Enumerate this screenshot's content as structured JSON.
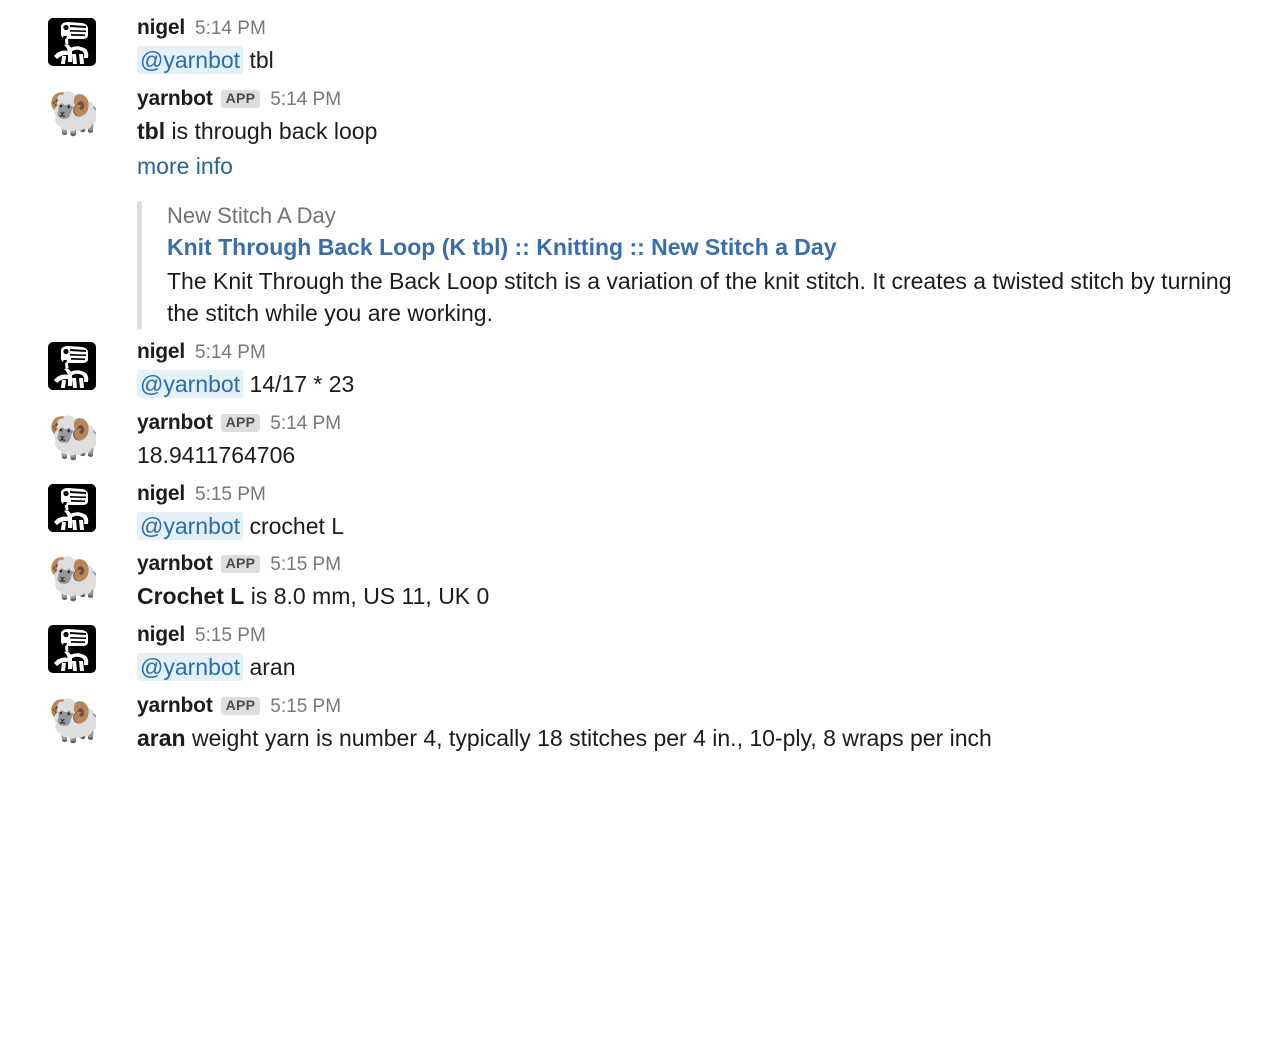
{
  "app": "slack",
  "colors": {
    "mention_bg": "#e4f1f8",
    "mention_text": "#2a6cae",
    "link": "#2a6496",
    "attachment_bar": "#dddddd",
    "attachment_title": "#3a6ea8",
    "app_badge_bg": "#dddddd",
    "timestamp": "#787878",
    "body_text": "#1d1c1d",
    "service_text": "#717274"
  },
  "users": {
    "nigel": {
      "name": "nigel",
      "avatar_icon": "trex-skeleton-avatar"
    },
    "yarnbot": {
      "name": "yarnbot",
      "avatar_icon": "ram-emoji-avatar",
      "badge": "APP"
    }
  },
  "messages": [
    {
      "id": "m1",
      "author": "nigel",
      "avatar_icon": "trex-skeleton-avatar",
      "badge": "",
      "time": "5:14 PM",
      "mention": "@yarnbot",
      "text": "tbl"
    },
    {
      "id": "m2",
      "author": "yarnbot",
      "avatar_icon": "ram-emoji-avatar",
      "badge": "APP",
      "time": "5:14 PM",
      "bold_prefix": "tbl",
      "text": " is through back loop",
      "link_label": "more info",
      "attachment": {
        "service": "New Stitch A Day",
        "title": "Knit Through Back Loop (K tbl) :: Knitting :: New Stitch a Day",
        "text": "The Knit Through the Back Loop stitch is a variation of the knit stitch. It creates a twisted stitch by turning the stitch while you are working."
      }
    },
    {
      "id": "m3",
      "author": "nigel",
      "avatar_icon": "trex-skeleton-avatar",
      "badge": "",
      "time": "5:14 PM",
      "mention": "@yarnbot",
      "text": "14/17 * 23"
    },
    {
      "id": "m4",
      "author": "yarnbot",
      "avatar_icon": "ram-emoji-avatar",
      "badge": "APP",
      "time": "5:14 PM",
      "bold_prefix": "",
      "text": "18.9411764706"
    },
    {
      "id": "m5",
      "author": "nigel",
      "avatar_icon": "trex-skeleton-avatar",
      "badge": "",
      "time": "5:15 PM",
      "mention": "@yarnbot",
      "text": "crochet L"
    },
    {
      "id": "m6",
      "author": "yarnbot",
      "avatar_icon": "ram-emoji-avatar",
      "badge": "APP",
      "time": "5:15 PM",
      "bold_prefix": "Crochet L",
      "text": " is 8.0 mm, US 11, UK 0"
    },
    {
      "id": "m7",
      "author": "nigel",
      "avatar_icon": "trex-skeleton-avatar",
      "badge": "",
      "time": "5:15 PM",
      "mention": "@yarnbot",
      "text": "aran"
    },
    {
      "id": "m8",
      "author": "yarnbot",
      "avatar_icon": "ram-emoji-avatar",
      "badge": "APP",
      "time": "5:15 PM",
      "bold_prefix": "aran",
      "text": " weight yarn is number 4, typically 18 stitches per 4 in., 10-ply, 8 wraps per inch"
    }
  ]
}
